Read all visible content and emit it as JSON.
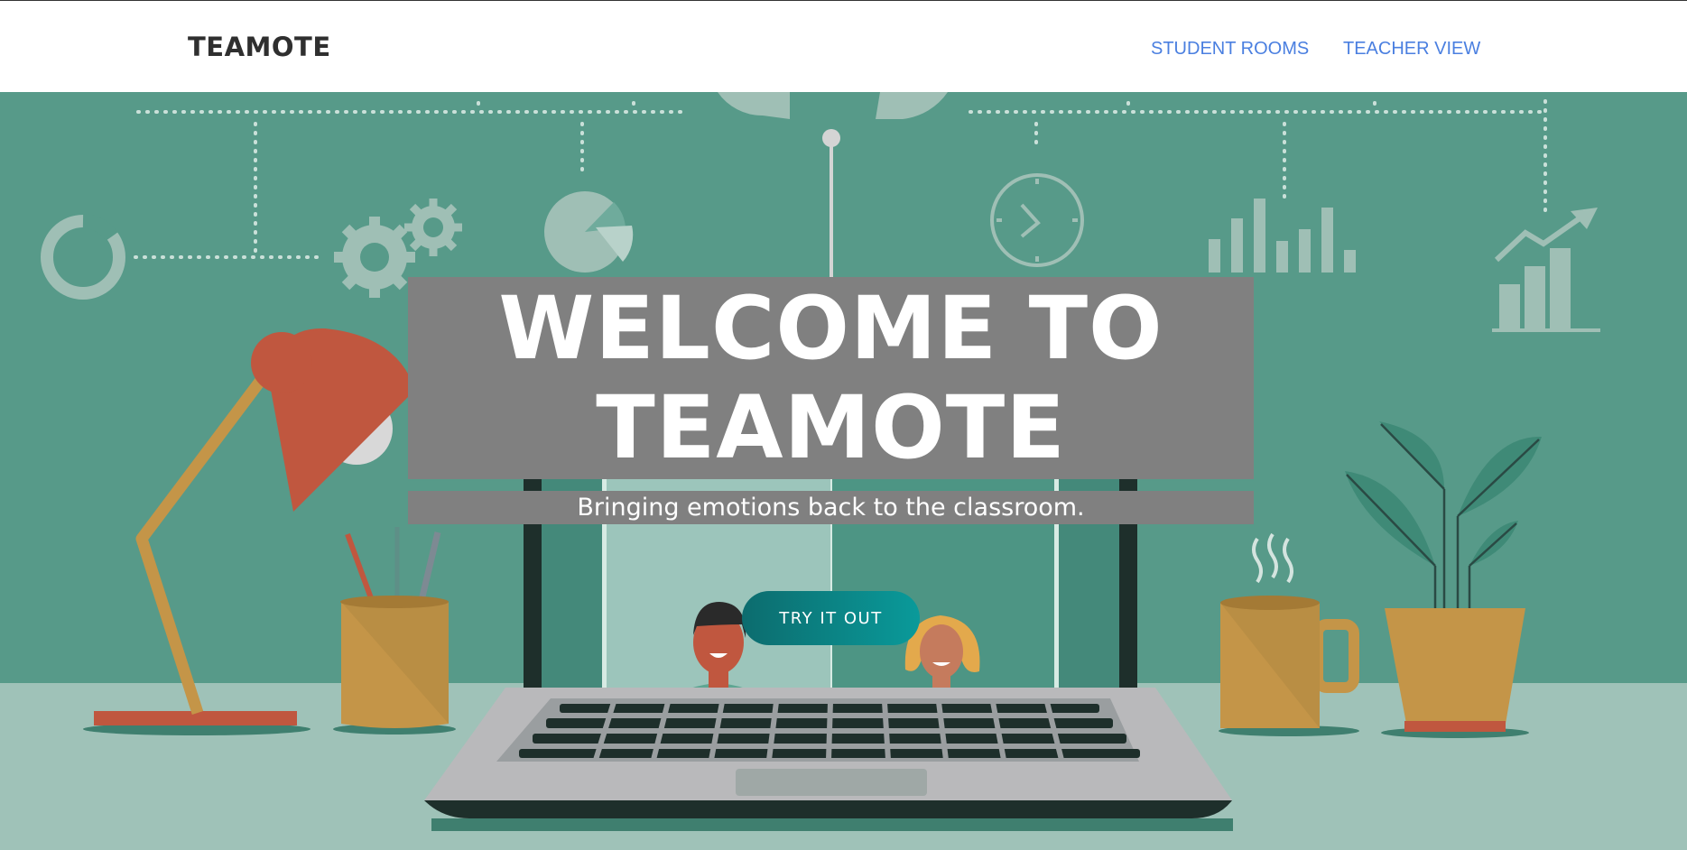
{
  "navbar": {
    "brand": "TEAMOTE",
    "links": [
      "STUDENT ROOMS",
      "TEACHER VIEW"
    ]
  },
  "hero": {
    "title_line1": "WELCOME TO",
    "title_line2": "TEAMOTE",
    "subtitle": "Bringing emotions back to the classroom.",
    "cta_label": "TRY IT OUT"
  },
  "colors": {
    "wall": "#579a89",
    "desk": "#9fc2b8",
    "nav_link": "#4a7fe0",
    "title_box": "#808080",
    "cta_start": "#0c6c6e",
    "cta_end": "#0a9a9a",
    "lamp_red": "#c0573f",
    "mustard": "#c49548"
  },
  "icons": [
    "donut-chart-icon",
    "gears-icon",
    "pie-chart-icon",
    "refresh-icon",
    "clock-icon",
    "bar-chart-icon",
    "trend-chart-icon"
  ]
}
